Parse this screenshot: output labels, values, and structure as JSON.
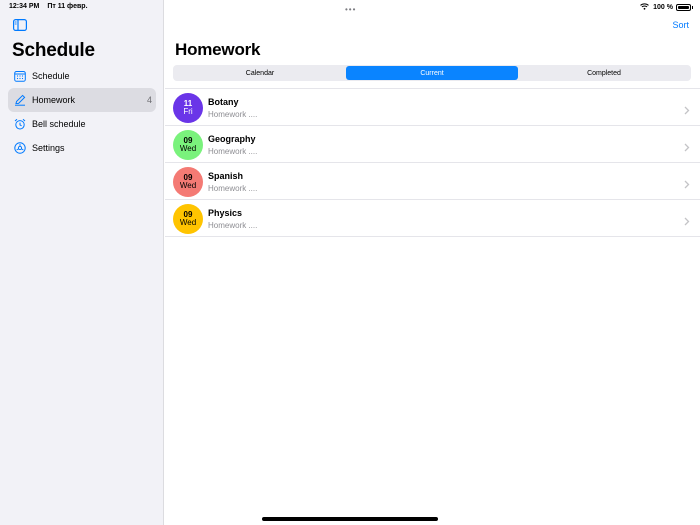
{
  "status_bar": {
    "time": "12:34 PM",
    "date": "Пт 11 февр.",
    "battery": "100 %"
  },
  "sidebar": {
    "title": "Schedule",
    "items": [
      {
        "label": "Schedule",
        "icon": "calendar-icon",
        "badge": ""
      },
      {
        "label": "Homework",
        "icon": "pencil-icon",
        "badge": "4"
      },
      {
        "label": "Bell schedule",
        "icon": "alarm-clock-icon",
        "badge": ""
      },
      {
        "label": "Settings",
        "icon": "gear-icon",
        "badge": ""
      }
    ],
    "active_index": 1
  },
  "main": {
    "sort_label": "Sort",
    "title": "Homework",
    "segments": [
      "Calendar",
      "Current",
      "Completed"
    ],
    "selected_segment": 1,
    "rows": [
      {
        "day": "11",
        "weekday": "Fri",
        "subject": "Botany",
        "desc": "Homework ....",
        "color": "#6a35e8",
        "text_color": "#ffffff"
      },
      {
        "day": "09",
        "weekday": "Wed",
        "subject": "Geography",
        "desc": "Homework ....",
        "color": "#7af27c",
        "text_color": "#000000"
      },
      {
        "day": "09",
        "weekday": "Wed",
        "subject": "Spanish",
        "desc": "Homework ....",
        "color": "#f47a74",
        "text_color": "#000000"
      },
      {
        "day": "09",
        "weekday": "Wed",
        "subject": "Physics",
        "desc": "Homework ....",
        "color": "#ffc400",
        "text_color": "#000000"
      }
    ]
  },
  "colors": {
    "accent": "#007aff",
    "sidebar_bg": "#f2f2f7"
  }
}
